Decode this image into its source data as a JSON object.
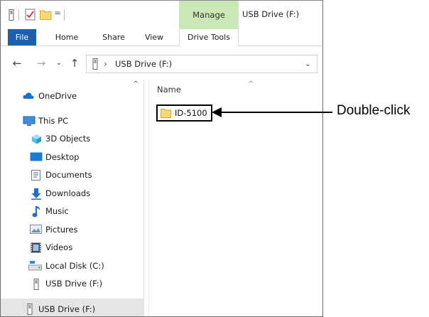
{
  "titlebar": {
    "manage_label": "Manage",
    "title": "USB Drive (F:)",
    "qat_separator": "="
  },
  "ribbon_tabs": {
    "file": "File",
    "home": "Home",
    "share": "Share",
    "view": "View",
    "drive_tools": "Drive Tools"
  },
  "address": {
    "path": "USB Drive (F:)",
    "breadcrumb_sep": "›"
  },
  "nav_pane": {
    "items": [
      {
        "label": "OneDrive",
        "icon": "cloud-icon"
      },
      {
        "label": "This PC",
        "icon": "computer-icon"
      },
      {
        "label": "3D Objects",
        "icon": "cube-icon"
      },
      {
        "label": "Desktop",
        "icon": "desktop-icon"
      },
      {
        "label": "Documents",
        "icon": "document-icon"
      },
      {
        "label": "Downloads",
        "icon": "download-icon"
      },
      {
        "label": "Music",
        "icon": "music-icon"
      },
      {
        "label": "Pictures",
        "icon": "pictures-icon"
      },
      {
        "label": "Videos",
        "icon": "video-icon"
      },
      {
        "label": "Local Disk (C:)",
        "icon": "disk-icon"
      },
      {
        "label": "USB Drive (F:)",
        "icon": "usb-drive-icon"
      },
      {
        "label": "USB Drive (F:)",
        "icon": "usb-drive-icon",
        "selected": true
      }
    ]
  },
  "content": {
    "column_name": "Name",
    "files": [
      {
        "name": "ID-5100",
        "type": "folder"
      }
    ]
  },
  "annotation": {
    "text": "Double-click"
  },
  "colors": {
    "manage_tab": "#c9e8b5",
    "file_tab": "#1c5fb0",
    "folder": "#f8d775"
  }
}
